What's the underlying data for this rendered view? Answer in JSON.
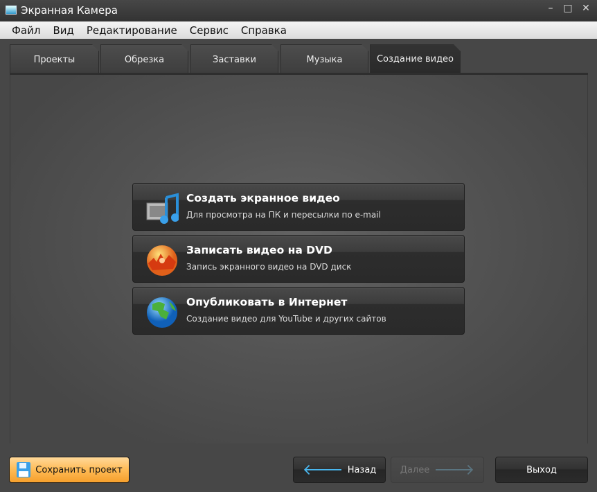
{
  "window": {
    "title": "Экранная Камера",
    "minimize": "–",
    "maximize": "□",
    "close": "✕"
  },
  "menu": [
    "Файл",
    "Вид",
    "Редактирование",
    "Сервис",
    "Справка"
  ],
  "tabs": [
    "Проекты",
    "Обрезка",
    "Заставки",
    "Музыка",
    "Создание видео"
  ],
  "active_tab": "Создание видео",
  "options": [
    {
      "title": "Создать экранное видео",
      "subtitle": "Для просмотра на ПК и пересылки по e-mail",
      "icon": "video-music-icon"
    },
    {
      "title": "Записать видео на DVD",
      "subtitle": "Запись экранного видео на DVD диск",
      "icon": "dvd-disc-icon"
    },
    {
      "title": "Опубликовать в Интернет",
      "subtitle": "Создание видео для YouTube и других сайтов",
      "icon": "globe-icon"
    }
  ],
  "footer": {
    "save": "Сохранить проект",
    "back": "Назад",
    "next": "Далее",
    "exit": "Выход",
    "back_arrow": "🡐",
    "next_arrow": "🡒"
  }
}
